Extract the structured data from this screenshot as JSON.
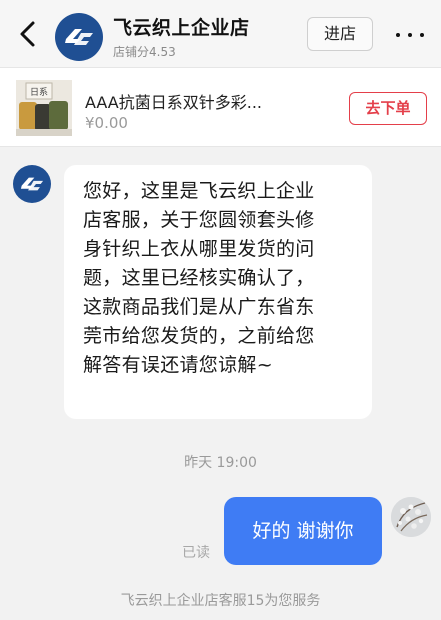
{
  "header": {
    "shop_name": "飞云织上企业店",
    "shop_score": "店铺分4.53",
    "enter_store_label": "进店"
  },
  "product": {
    "title": "AAA抗菌日系双针多彩...",
    "price": "¥0.00",
    "order_button_label": "去下单",
    "thumb_label": "日系"
  },
  "chat": {
    "agent_message_lines": [
      "您好，这里是飞云织上企业",
      "店客服，关于您圆领套头修",
      "身针织上衣从哪里发货的问",
      "题，这里已经核实确认了，",
      "这款商品我们是从广东省东",
      "莞市给您发货的，之前给您",
      "解答有误还请您谅解~"
    ],
    "timestamp": "昨天 19:00",
    "user_message": "好的 谢谢你",
    "read_status": "已读"
  },
  "footer": {
    "service_notice": "飞云织上企业店客服15为您服务"
  },
  "colors": {
    "accent_blue": "#3f7cf4",
    "order_red": "#e43f4a",
    "logo_blue": "#1f4f93"
  }
}
